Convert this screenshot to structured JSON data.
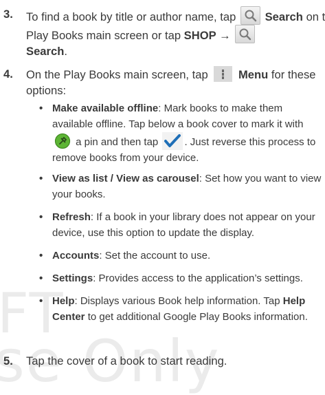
{
  "watermark": [
    "FT",
    "se Only"
  ],
  "step3": {
    "number": "3.",
    "t1": "To find a book by title or author name, tap",
    "search_label": "Search",
    "t2": "on the Play Books main screen or tap",
    "shop_path": "SHOP →",
    "search_label2": "Search",
    "t3": "."
  },
  "step4": {
    "number": "4.",
    "t1": "On the Play Books main screen, tap",
    "menu_label": "Menu",
    "t2": "for these options:",
    "bullets": [
      {
        "term": "Make available offline",
        "t1": ": Mark books to make them available offline. Tap below a book cover to mark it with",
        "t2": "a pin and then tap",
        "t3": ". Just reverse this process to remove books from your device."
      },
      {
        "term": "View as list / View as carousel",
        "t1": ": Set how you want to view your books."
      },
      {
        "term": "Refresh",
        "t1": ": If a book in your library does not appear on your device, use this option to update the display."
      },
      {
        "term": "Accounts",
        "t1": ": Set the account to use."
      },
      {
        "term": "Settings",
        "t1": ": Provides access to the application’s settings."
      },
      {
        "term": "Help",
        "t1": ": Displays various Book help information. Tap",
        "term2": "Help Center",
        "t2": "to get additional Google Play Books information."
      }
    ]
  },
  "step5": {
    "number": "5.",
    "t1": "Tap the cover of a book to start reading."
  },
  "icons": {
    "search": "search-icon",
    "menu": "menu-icon",
    "pin": "pin-icon",
    "check": "checkmark-icon"
  },
  "colors": {
    "text": "#3a3a3a",
    "watermark": "#ebebeb",
    "pin_green": "#5db535",
    "check_blue": "#1f6fb7"
  }
}
